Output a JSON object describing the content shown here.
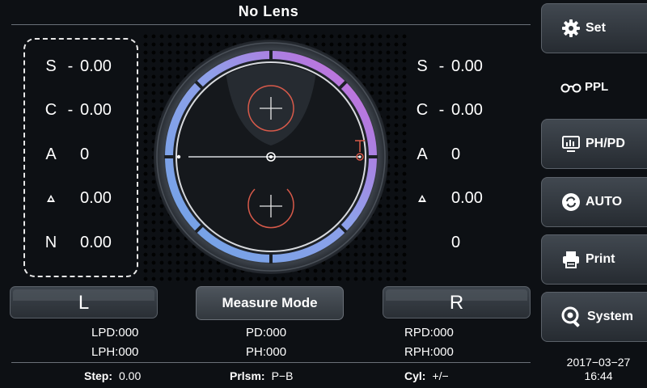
{
  "header": {
    "title": "No  Lens"
  },
  "left_panel": {
    "rows": [
      {
        "label": "S",
        "sign": "-",
        "value": "0.00"
      },
      {
        "label": "C",
        "sign": "-",
        "value": "0.00"
      },
      {
        "label": "A",
        "sign": "",
        "value": "0"
      },
      {
        "label": "prism-icon",
        "sign": "",
        "value": "0.00"
      },
      {
        "label": "N",
        "sign": "",
        "value": "0.00"
      }
    ]
  },
  "right_panel": {
    "rows": [
      {
        "label": "S",
        "sign": "-",
        "value": "0.00"
      },
      {
        "label": "C",
        "sign": "-",
        "value": "0.00"
      },
      {
        "label": "A",
        "sign": "",
        "value": "0"
      },
      {
        "label": "prism-icon",
        "sign": "",
        "value": "0.00"
      },
      {
        "label": "",
        "sign": "",
        "value": "0"
      }
    ]
  },
  "buttons": {
    "left": "L",
    "measure_mode": "Measure Mode",
    "right": "R"
  },
  "readouts": {
    "lpd": "LPD:000",
    "pd": "PD:000",
    "rpd": "RPD:000",
    "lph": "LPH:000",
    "ph": "PH:000",
    "rph": "RPH:000"
  },
  "bottom": {
    "step_label": "Step:",
    "step_value": "0.00",
    "prism_label": "Prlsm:",
    "prism_value": "P−B",
    "cyl_label": "Cyl:",
    "cyl_value": "+/−"
  },
  "sidebar": {
    "set": "Set",
    "ppl": "PPL",
    "phpd": "PH/PD",
    "auto": "AUTO",
    "print": "Print",
    "system": "System"
  },
  "datetime": {
    "date": "2017−03−27",
    "time": "16:44"
  },
  "colors": {
    "background": "#0d1014",
    "ring_blue": "#6fa3e6",
    "ring_purple": "#b07be0",
    "ring_magenta": "#d86ad8",
    "target_red": "#d85a4a"
  }
}
